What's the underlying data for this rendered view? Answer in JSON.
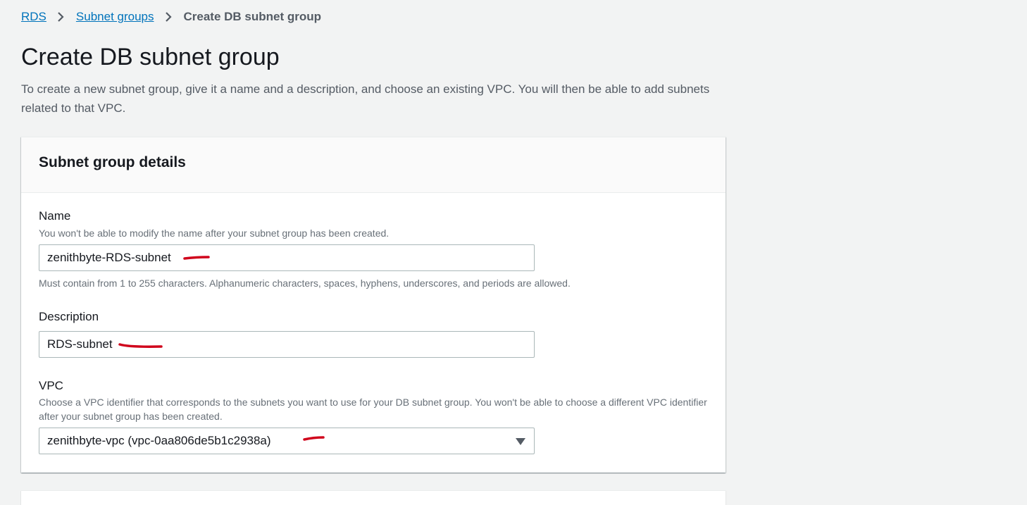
{
  "breadcrumb": {
    "items": [
      {
        "label": "RDS"
      },
      {
        "label": "Subnet groups"
      }
    ],
    "current": "Create DB subnet group"
  },
  "page": {
    "title": "Create DB subnet group",
    "description": "To create a new subnet group, give it a name and a description, and choose an existing VPC. You will then be able to add subnets related to that VPC."
  },
  "panel": {
    "title": "Subnet group details",
    "name": {
      "label": "Name",
      "hint": "You won't be able to modify the name after your subnet group has been created.",
      "value": "zenithbyte-RDS-subnet",
      "constraint": "Must contain from 1 to 255 characters. Alphanumeric characters, spaces, hyphens, underscores, and periods are allowed."
    },
    "description": {
      "label": "Description",
      "value": "RDS-subnet"
    },
    "vpc": {
      "label": "VPC",
      "hint": "Choose a VPC identifier that corresponds to the subnets you want to use for your DB subnet group. You won't be able to choose a different VPC identifier after your subnet group has been created.",
      "selected": "zenithbyte-vpc (vpc-0aa806de5b1c2938a)"
    }
  },
  "icons": {
    "separator": "chevron-right-icon",
    "dropdown": "caret-down-icon"
  },
  "colors": {
    "link": "#0073bb",
    "annotation": "#d0021b"
  }
}
